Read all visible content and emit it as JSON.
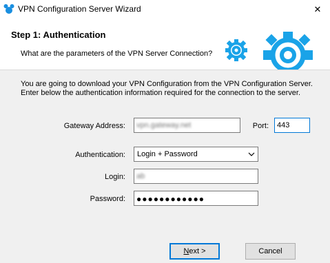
{
  "window": {
    "title": "VPN Configuration Server Wizard",
    "close_glyph": "✕"
  },
  "header": {
    "step_title": "Step 1: Authentication",
    "subtitle": "What are the parameters of the VPN Server Connection?",
    "icon": "gears-icon"
  },
  "intro": {
    "line1": "You are going to download your VPN Configuration from the VPN Configuration Server.",
    "line2": "Enter below the authentication information required for the connection to the server."
  },
  "form": {
    "gateway_label": "Gateway Address:",
    "gateway_value": "vpn.gateway.net",
    "port_label": "Port:",
    "port_value": "443",
    "auth_label": "Authentication:",
    "auth_value": "Login + Password",
    "login_label": "Login:",
    "login_value": "ab",
    "password_label": "Password:",
    "password_value": "●●●●●●●●●●●●"
  },
  "buttons": {
    "next_first": "N",
    "next_rest": "ext >",
    "cancel": "Cancel"
  },
  "colors": {
    "accent": "#0078d7",
    "gear": "#1aa3e8"
  }
}
